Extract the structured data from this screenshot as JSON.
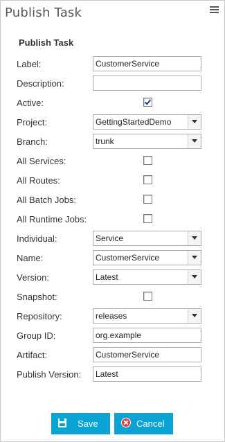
{
  "header": {
    "title": "Publish Task",
    "menu_icon": "hamburger-menu-icon"
  },
  "form": {
    "section_title": "Publish Task",
    "label": {
      "label": "Label:",
      "value": "CustomerService"
    },
    "description": {
      "label": "Description:",
      "value": ""
    },
    "active": {
      "label": "Active:",
      "checked": true
    },
    "project": {
      "label": "Project:",
      "value": "GettingStartedDemo"
    },
    "branch": {
      "label": "Branch:",
      "value": "trunk"
    },
    "all_services": {
      "label": "All Services:",
      "checked": false
    },
    "all_routes": {
      "label": "All Routes:",
      "checked": false
    },
    "all_batch_jobs": {
      "label": "All Batch Jobs:",
      "checked": false
    },
    "all_runtime_jobs": {
      "label": "All Runtime Jobs:",
      "checked": false
    },
    "individual": {
      "label": "Individual:",
      "value": "Service"
    },
    "name": {
      "label": "Name:",
      "value": "CustomerService"
    },
    "version": {
      "label": "Version:",
      "value": "Latest"
    },
    "snapshot": {
      "label": "Snapshot:",
      "checked": false
    },
    "repository": {
      "label": "Repository:",
      "value": "releases"
    },
    "group_id": {
      "label": "Group ID:",
      "value": "org.example"
    },
    "artifact": {
      "label": "Artifact:",
      "value": "CustomerService"
    },
    "publish_version": {
      "label": "Publish Version:",
      "value": "Latest"
    }
  },
  "buttons": {
    "save_label": "Save",
    "cancel_label": "Cancel"
  },
  "colors": {
    "button_bg": "#0aa3d4",
    "cancel_icon": "#e03a3a"
  }
}
